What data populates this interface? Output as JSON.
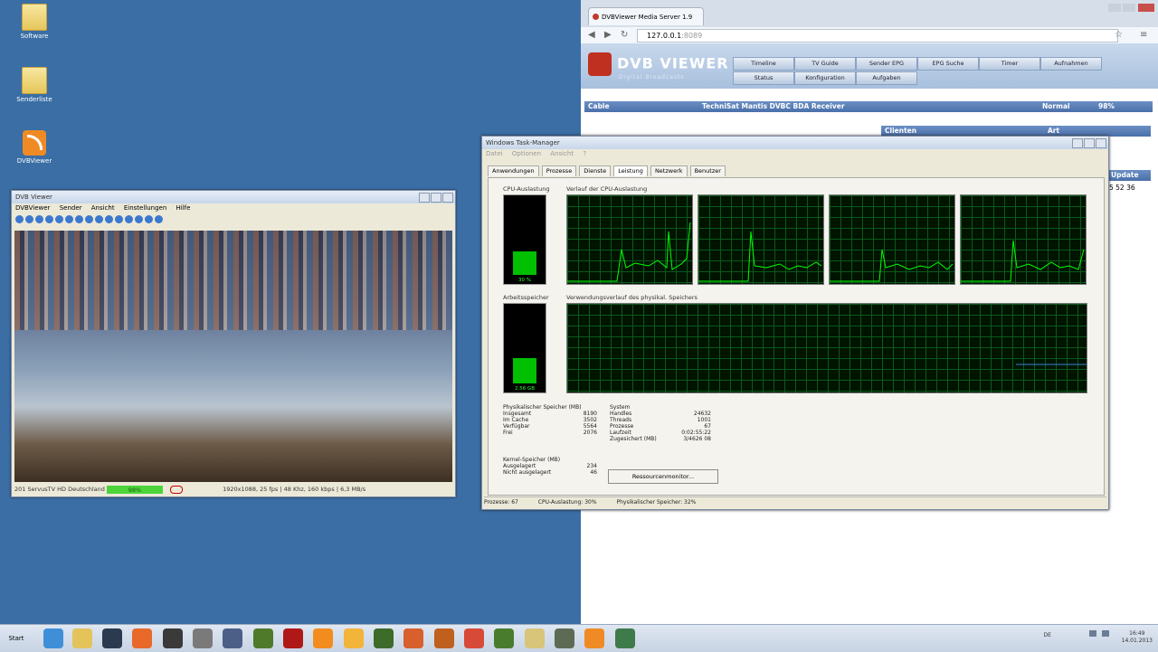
{
  "desktop": {
    "icons": [
      {
        "label": "Software",
        "kind": "folder"
      },
      {
        "label": "Senderliste",
        "kind": "folder"
      },
      {
        "label": "DVBViewer",
        "kind": "rss"
      }
    ]
  },
  "dvbviewer": {
    "title": "DVB Viewer",
    "menu": [
      "DVBViewer",
      "Sender",
      "Ansicht",
      "Einstellungen",
      "Hilfe"
    ],
    "status": {
      "channel": "201 ServusTV HD Deutschland",
      "signal": "98%",
      "info": "1920x1088, 25 fps | 48 Khz, 160 kbps | 6,3 MB/s"
    }
  },
  "browser": {
    "tab_title": "DVBViewer Media Server 1.9",
    "url_host": "127.0.0.1",
    "url_port": ":8089",
    "logo": "DVB VIEWER",
    "logo_sub": "Digital Broadcasts",
    "nav_row1": [
      "Timeline",
      "TV Guide",
      "Sender EPG",
      "EPG Suche",
      "Timer",
      "Aufnahmen"
    ],
    "nav_row2": [
      "Status",
      "Konfiguration",
      "Aufgaben"
    ],
    "device": {
      "type": "Cable",
      "name": "TechniSat Mantis DVBC BDA Receiver",
      "mode": "Normal",
      "signal": "98%"
    },
    "clients_header": "Clienten",
    "clients_col": "Art",
    "update_label": "Update",
    "update_time": "5 52 36"
  },
  "taskmgr": {
    "title": "Windows Task-Manager",
    "menu": [
      "Datei",
      "Optionen",
      "Ansicht",
      "?"
    ],
    "tabs": [
      "Anwendungen",
      "Prozesse",
      "Dienste",
      "Leistung",
      "Netzwerk",
      "Benutzer"
    ],
    "active_tab": "Leistung",
    "cpu_label": "CPU-Auslastung",
    "cpu_history_label": "Verlauf der CPU-Auslastung",
    "cpu_value": "30 %",
    "mem_label": "Arbeitsspeicher",
    "mem_history_label": "Verwendungsverlauf des physikal. Speichers",
    "mem_value": "2,56 GB",
    "phys_title": "Physikalischer Speicher (MB)",
    "phys": [
      [
        "Insgesamt",
        "8190"
      ],
      [
        "Im Cache",
        "3502"
      ],
      [
        "Verfügbar",
        "5564"
      ],
      [
        "Frei",
        "2076"
      ]
    ],
    "kernel_title": "Kernel-Speicher (MB)",
    "kernel": [
      [
        "Ausgelagert",
        "234"
      ],
      [
        "Nicht ausgelagert",
        "46"
      ]
    ],
    "system_title": "System",
    "system": [
      [
        "Handles",
        "24632"
      ],
      [
        "Threads",
        "1001"
      ],
      [
        "Prozesse",
        "67"
      ],
      [
        "Laufzeit",
        "0:02:55:22"
      ],
      [
        "Zugesichert (MB)",
        "3/4626 08"
      ]
    ],
    "res_button": "Ressourcenmonitor...",
    "status": {
      "processes": "Prozesse: 67",
      "cpu": "CPU-Auslastung: 30%",
      "mem": "Physikalischer Speicher: 32%"
    }
  },
  "taskbar": {
    "start": "Start",
    "lang": "DE",
    "clock_time": "16:49",
    "clock_date": "14.01.2013"
  },
  "colors": {
    "desktop": "#3a6ea5",
    "graph_line": "#00ff00",
    "signal": "#4cd43a"
  }
}
